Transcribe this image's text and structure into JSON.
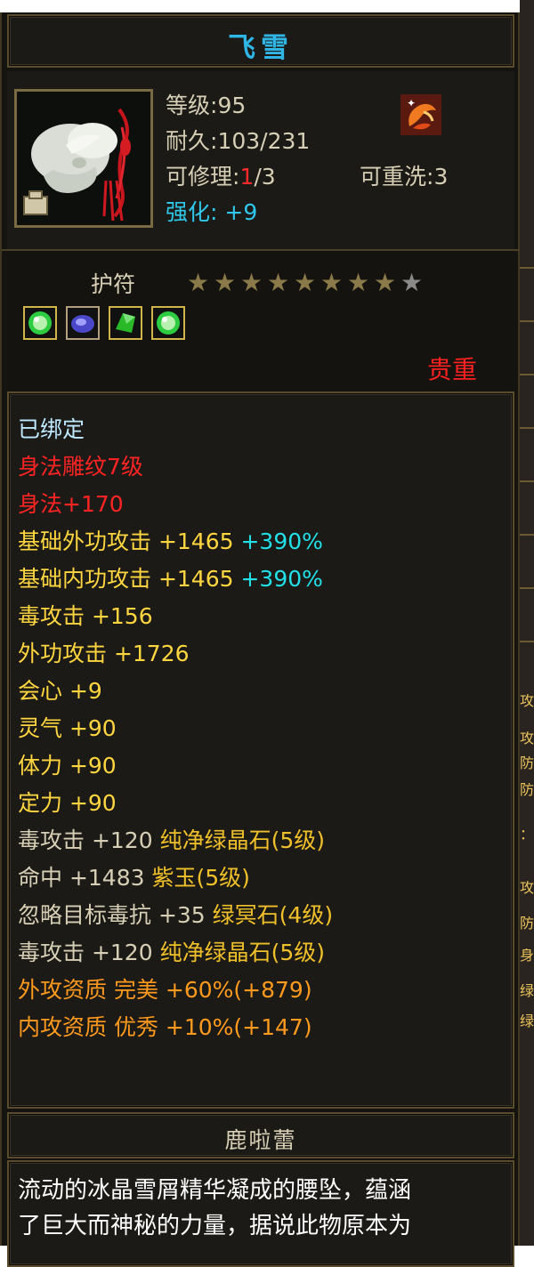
{
  "item": {
    "name": "飞雪",
    "level_label": "等级:",
    "level_value": "95",
    "durability_label": "耐久:",
    "durability_value": "103/231",
    "repair_label": "可修理:",
    "repair_current": "1",
    "repair_max": "/3",
    "rewash_label": "可重洗:",
    "rewash_value": "3",
    "enhance_label": "强化:",
    "enhance_value": "+9",
    "type": "护符",
    "stars_filled": 8,
    "stars_total": 9,
    "rarity": "贵重",
    "owner": "鹿啦蕾"
  },
  "properties": [
    {
      "segments": [
        {
          "text": "已绑定",
          "color": "cyan"
        }
      ]
    },
    {
      "segments": [
        {
          "text": "身法雕纹7级",
          "color": "red"
        }
      ]
    },
    {
      "segments": [
        {
          "text": "身法+170",
          "color": "red"
        }
      ]
    },
    {
      "segments": [
        {
          "text": "基础外功攻击 +1465 ",
          "color": "yellow"
        },
        {
          "text": "+390%",
          "color": "aqua"
        }
      ]
    },
    {
      "segments": [
        {
          "text": "基础内功攻击 +1465 ",
          "color": "yellow"
        },
        {
          "text": "+390%",
          "color": "aqua"
        }
      ]
    },
    {
      "segments": [
        {
          "text": "毒攻击 +156",
          "color": "yellow"
        }
      ]
    },
    {
      "segments": [
        {
          "text": "外功攻击 +1726",
          "color": "yellow"
        }
      ]
    },
    {
      "segments": [
        {
          "text": "会心 +9",
          "color": "yellow"
        }
      ]
    },
    {
      "segments": [
        {
          "text": "灵气 +90",
          "color": "yellow"
        }
      ]
    },
    {
      "segments": [
        {
          "text": "体力 +90",
          "color": "yellow"
        }
      ]
    },
    {
      "segments": [
        {
          "text": "定力 +90",
          "color": "yellow"
        }
      ]
    },
    {
      "segments": [
        {
          "text": "毒攻击 +120 ",
          "color": "white"
        },
        {
          "text": "纯净绿晶石(5级)",
          "color": "gold"
        }
      ]
    },
    {
      "segments": [
        {
          "text": "命中 +1483 ",
          "color": "white"
        },
        {
          "text": "紫玉(5级)",
          "color": "gold"
        }
      ]
    },
    {
      "segments": [
        {
          "text": "忽略目标毒抗 +35 ",
          "color": "white"
        },
        {
          "text": "绿冥石(4级)",
          "color": "gold"
        }
      ]
    },
    {
      "segments": [
        {
          "text": "毒攻击 +120 ",
          "color": "white"
        },
        {
          "text": "纯净绿晶石(5级)",
          "color": "gold"
        }
      ]
    },
    {
      "segments": [
        {
          "text": "外攻资质  完美 +60%(+879)",
          "color": "orange"
        }
      ]
    },
    {
      "segments": [
        {
          "text": "内攻资质  优秀 +10%(+147)",
          "color": "orange"
        }
      ]
    }
  ],
  "description": [
    "流动的冰晶雪屑精华凝成的腰坠，蕴涵",
    "了巨大而神秘的力量，据说此物原本为"
  ],
  "colors": {
    "white": "#d7cfb5",
    "cyan": "#bfe9ff",
    "red": "#ff2424",
    "yellow": "#ffd640",
    "orange": "#ff9a1e",
    "aqua": "#22e0e8",
    "gold": "#f0c02a",
    "star_filled": "#8a7a4a",
    "star_empty": "#8a8a8a"
  },
  "gems": [
    {
      "icon": "green-gem-icon",
      "color": "#2ecc40"
    },
    {
      "icon": "purple-gem-icon",
      "color": "#5a5ae0"
    },
    {
      "icon": "green-crystal-icon",
      "color": "#28b828"
    },
    {
      "icon": "green-gem-icon",
      "color": "#2ecc40"
    }
  ],
  "side_strip_chars": [
    "攻",
    "攻",
    "防",
    "防",
    "：",
    "攻",
    "防",
    "身",
    "绿",
    "绿"
  ]
}
